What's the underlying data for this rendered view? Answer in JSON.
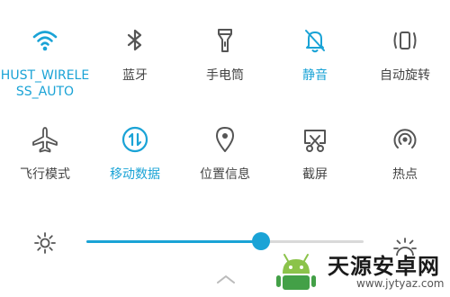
{
  "accent_color": "#1aa3d6",
  "tiles": [
    {
      "label": "HUST_WIRELE\nSS_AUTO",
      "icon": "wifi-icon",
      "active": true
    },
    {
      "label": "蓝牙",
      "icon": "bluetooth-icon",
      "active": false
    },
    {
      "label": "手电筒",
      "icon": "flashlight-icon",
      "active": false
    },
    {
      "label": "静音",
      "icon": "mute-bell-icon",
      "active": true
    },
    {
      "label": "自动旋转",
      "icon": "rotate-icon",
      "active": false
    },
    {
      "label": "飞行模式",
      "icon": "airplane-icon",
      "active": false
    },
    {
      "label": "移动数据",
      "icon": "mobile-data-icon",
      "active": true
    },
    {
      "label": "位置信息",
      "icon": "location-icon",
      "active": false
    },
    {
      "label": "截屏",
      "icon": "screenshot-icon",
      "active": false
    },
    {
      "label": "热点",
      "icon": "hotspot-icon",
      "active": false
    }
  ],
  "brightness": {
    "level": 0.63
  },
  "watermark": {
    "text": "天源安卓网",
    "url": "www.jytyaz.com"
  }
}
